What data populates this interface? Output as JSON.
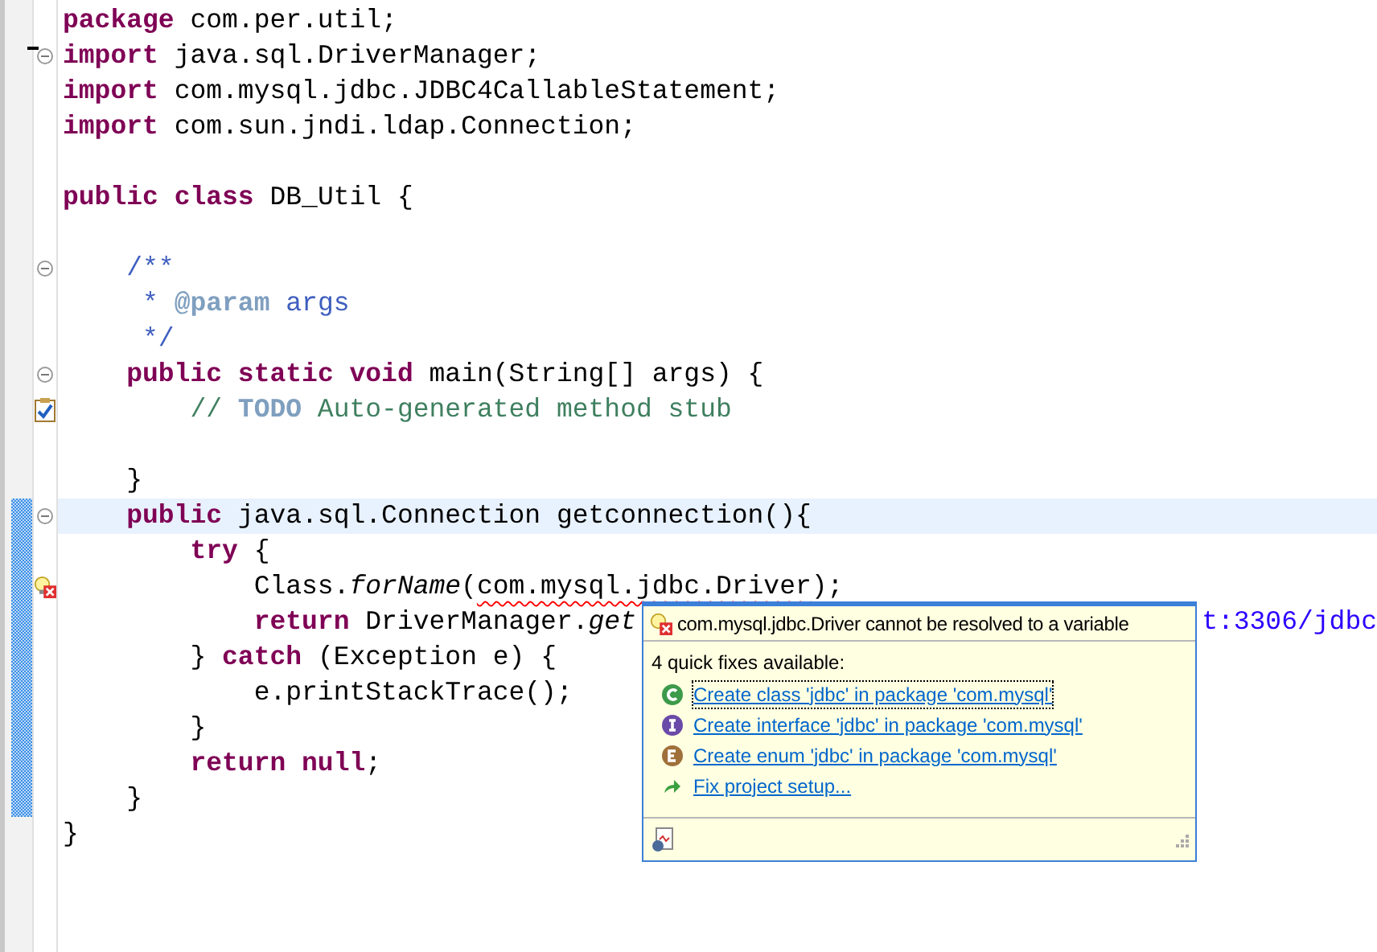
{
  "editor": {
    "lines": [
      {
        "kind": "code",
        "tokens": [
          {
            "text": "package",
            "kind": "kw"
          },
          {
            "text": " com.per.util;",
            "kind": "plain"
          }
        ]
      },
      {
        "kind": "fold",
        "tokens": [
          {
            "text": "import",
            "kind": "kw"
          },
          {
            "text": " java.sql.DriverManager;",
            "kind": "plain"
          }
        ]
      },
      {
        "kind": "code",
        "tokens": [
          {
            "text": "import",
            "kind": "kw"
          },
          {
            "text": " com.mysql.jdbc.JDBC4CallableStatement;",
            "kind": "plain"
          }
        ]
      },
      {
        "kind": "code",
        "tokens": [
          {
            "text": "import",
            "kind": "kw"
          },
          {
            "text": " com.sun.jndi.ldap.Connection;",
            "kind": "plain"
          }
        ]
      },
      {
        "kind": "code"
      },
      {
        "kind": "code",
        "tokens": [
          {
            "text": "public",
            "kind": "kw"
          },
          {
            "text": " class",
            "kind": "kw"
          },
          {
            "text": " DB_Util {",
            "kind": "plain"
          }
        ]
      },
      {
        "kind": "code"
      },
      {
        "kind": "fold",
        "tokens": [
          {
            "text": "    /**",
            "kind": "javadoc"
          }
        ]
      },
      {
        "kind": "code",
        "tokens": [
          {
            "text": "     * ",
            "kind": "javadoc"
          },
          {
            "text": "@param",
            "kind": "doctag"
          },
          {
            "text": " args",
            "kind": "javadoc"
          }
        ]
      },
      {
        "kind": "code",
        "tokens": [
          {
            "text": "     */",
            "kind": "javadoc"
          }
        ]
      },
      {
        "kind": "fold",
        "tokens": [
          {
            "text": "    public",
            "kind": "kw"
          },
          {
            "text": " static",
            "kind": "kw"
          },
          {
            "text": " void",
            "kind": "kw"
          },
          {
            "text": " main(String[] args) {",
            "kind": "plain"
          }
        ]
      },
      {
        "kind": "task",
        "tokens": [
          {
            "text": "        // ",
            "kind": "comment"
          },
          {
            "text": "TODO",
            "kind": "todo"
          },
          {
            "text": " Auto-generated method stub",
            "kind": "comment"
          }
        ]
      },
      {
        "kind": "code"
      },
      {
        "kind": "code",
        "tokens": [
          {
            "text": "    }",
            "kind": "plain"
          }
        ]
      },
      {
        "kind": "fold",
        "changed": true,
        "current": true,
        "tokens": [
          {
            "text": "    public",
            "kind": "kw"
          },
          {
            "text": " java.sql.Connection getconnection(){",
            "kind": "plain"
          }
        ]
      },
      {
        "kind": "code",
        "changed": true,
        "tokens": [
          {
            "text": "        try",
            "kind": "kw"
          },
          {
            "text": " {",
            "kind": "plain"
          }
        ]
      },
      {
        "kind": "error",
        "changed": true,
        "tokens": [
          {
            "text": "            Class.",
            "kind": "plain"
          },
          {
            "text": "forName",
            "kind": "italic"
          },
          {
            "text": "(",
            "kind": "plain"
          },
          {
            "text": "com.mysql.jdbc.Driver",
            "kind": "error"
          },
          {
            "text": ");",
            "kind": "plain"
          }
        ]
      },
      {
        "kind": "code",
        "changed": true,
        "tokens": [
          {
            "text": "            return",
            "kind": "kw"
          },
          {
            "text": " DriverManager.",
            "kind": "plain"
          },
          {
            "text": "get",
            "kind": "italic"
          }
        ],
        "tail": "t:3306/jdbc"
      },
      {
        "kind": "code",
        "changed": true,
        "tokens": [
          {
            "text": "        } ",
            "kind": "plain"
          },
          {
            "text": "catch",
            "kind": "kw"
          },
          {
            "text": " (Exception e) {",
            "kind": "plain"
          }
        ]
      },
      {
        "kind": "code",
        "changed": true,
        "tokens": [
          {
            "text": "            e.printStackTrace();",
            "kind": "plain"
          }
        ]
      },
      {
        "kind": "code",
        "changed": true,
        "tokens": [
          {
            "text": "        }",
            "kind": "plain"
          }
        ]
      },
      {
        "kind": "code",
        "changed": true,
        "tokens": [
          {
            "text": "        return",
            "kind": "kw"
          },
          {
            "text": " null",
            "kind": "kw"
          },
          {
            "text": ";",
            "kind": "plain"
          }
        ]
      },
      {
        "kind": "code",
        "changed": true,
        "tokens": [
          {
            "text": "    }",
            "kind": "plain"
          }
        ]
      },
      {
        "kind": "code",
        "tokens": [
          {
            "text": "}",
            "kind": "plain"
          }
        ]
      }
    ]
  },
  "quick_fix": {
    "message": "com.mysql.jdbc.Driver cannot be resolved to a variable",
    "summary": "4 quick fixes available:",
    "fixes": [
      {
        "label": "Create class 'jdbc' in package 'com.mysql'",
        "kind": "class",
        "selected": true
      },
      {
        "label": "Create interface 'jdbc' in package 'com.mysql'",
        "kind": "interface",
        "selected": false
      },
      {
        "label": "Create enum 'jdbc' in package 'com.mysql'",
        "kind": "enum",
        "selected": false
      },
      {
        "label": "Fix project setup...",
        "kind": "setup",
        "selected": false
      }
    ]
  }
}
